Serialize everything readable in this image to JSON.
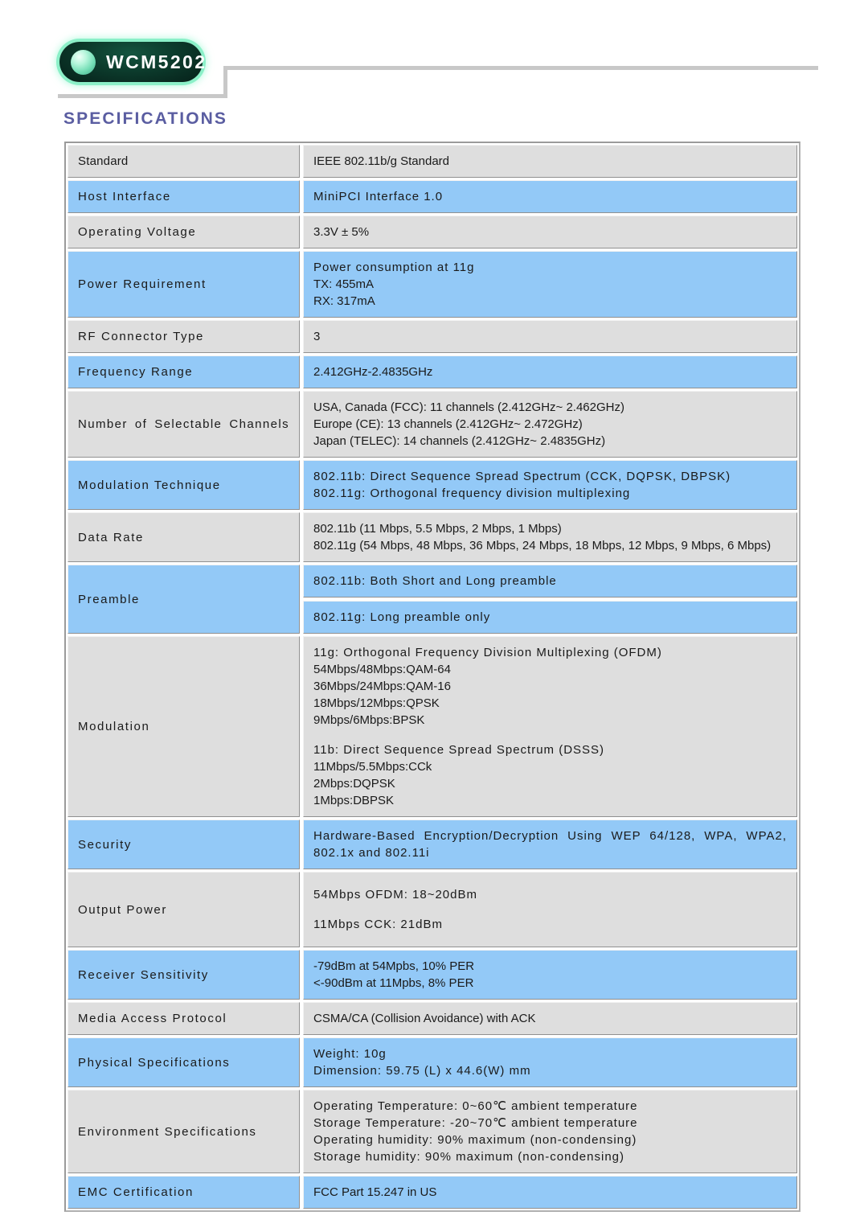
{
  "header": {
    "logo_text": "WCM5202",
    "logo_orb_icon": "sphere-icon"
  },
  "page_title": "SPECIFICATIONS",
  "colors": {
    "title": "#5a5da1",
    "row_blue": "#93c9f7",
    "row_gray": "#dedede",
    "rule": "#c8c8c8",
    "logo_dark": "#0c3b2c",
    "logo_glow": "#8bf0c8"
  },
  "spec_table": {
    "rows": [
      {
        "label": "Standard",
        "tint": "gray",
        "label_style": "normal",
        "value_style": "normal",
        "lines": [
          "IEEE 802.11b/g Standard"
        ]
      },
      {
        "label": "Host Interface",
        "tint": "blue",
        "label_style": "wide",
        "value_style": "wide",
        "lines": [
          "MiniPCI Interface 1.0"
        ]
      },
      {
        "label": "Operating Voltage",
        "tint": "gray",
        "label_style": "wide",
        "value_style": "normal",
        "lines": [
          "3.3V ± 5%"
        ]
      },
      {
        "label": "Power Requirement",
        "tint": "blue",
        "label_style": "wide",
        "value_style": "mixed",
        "lines": [
          "Power consumption at 11g",
          "TX: 455mA",
          "RX: 317mA"
        ]
      },
      {
        "label": "RF Connector Type",
        "tint": "gray",
        "label_style": "wide",
        "value_style": "normal",
        "lines": [
          "3"
        ]
      },
      {
        "label": "Frequency Range",
        "tint": "blue",
        "label_style": "wide",
        "value_style": "normal",
        "lines": [
          "2.412GHz-2.4835GHz"
        ]
      },
      {
        "label": "Number of Selectable Channels",
        "tint": "gray",
        "label_style": "justify",
        "label_words": [
          "Number",
          "of",
          "Selectable",
          "Channels"
        ],
        "value_style": "normal",
        "lines": [
          "USA, Canada (FCC): 11 channels (2.412GHz~ 2.462GHz)",
          "Europe (CE): 13 channels (2.412GHz~ 2.472GHz)",
          "Japan (TELEC): 14 channels (2.412GHz~ 2.4835GHz)"
        ]
      },
      {
        "label": "Modulation Technique",
        "tint": "blue",
        "label_style": "wide",
        "value_style": "wide",
        "lines": [
          "802.11b: Direct Sequence Spread Spectrum (CCK, DQPSK, DBPSK)",
          "802.11g: Orthogonal frequency division multiplexing"
        ]
      },
      {
        "label": "Data Rate",
        "tint": "gray",
        "label_style": "wide",
        "value_style": "normal",
        "lines": [
          "802.11b (11 Mbps, 5.5 Mbps, 2 Mbps, 1 Mbps)",
          "802.11g (54 Mbps, 48 Mbps, 36 Mbps, 24 Mbps, 18 Mbps, 12 Mbps, 9 Mbps, 6 Mbps)"
        ]
      },
      {
        "label": "Preamble",
        "tint": "blue",
        "label_style": "wide",
        "split": true,
        "subcells": [
          "802.11b: Both Short and Long preamble",
          "802.11g: Long preamble only"
        ]
      },
      {
        "label": "Modulation",
        "tint": "gray",
        "label_style": "wide",
        "value_style": "mixed",
        "lines": [
          "11g: Orthogonal Frequency Division Multiplexing (OFDM)",
          "54Mbps/48Mbps:QAM-64",
          "36Mbps/24Mbps:QAM-16",
          "18Mbps/12Mbps:QPSK",
          "9Mbps/6Mbps:BPSK",
          "",
          "11b: Direct Sequence Spread Spectrum (DSSS)",
          "11Mbps/5.5Mbps:CCk",
          "2Mbps:DQPSK",
          "1Mbps:DBPSK"
        ]
      },
      {
        "label": "Security",
        "tint": "blue",
        "label_style": "wide",
        "value_style": "justify",
        "lines": [
          "Hardware-Based Encryption/Decryption Using WEP 64/128, WPA, WPA2, 802.1x and 802.11i"
        ]
      },
      {
        "label": "Output Power",
        "tint": "gray",
        "label_style": "wide",
        "value_style": "spaced",
        "lines": [
          "54Mbps OFDM: 18~20dBm",
          "11Mbps CCK: 21dBm"
        ]
      },
      {
        "label": "Receiver Sensitivity",
        "tint": "blue",
        "label_style": "wide",
        "value_style": "normal",
        "lines": [
          "-79dBm at 54Mpbs, 10% PER",
          "<-90dBm at 11Mpbs, 8% PER"
        ]
      },
      {
        "label": "Media Access Protocol",
        "tint": "gray",
        "label_style": "wide",
        "value_style": "normal",
        "lines": [
          "CSMA/CA (Collision Avoidance) with ACK"
        ]
      },
      {
        "label": "Physical Specifications",
        "tint": "blue",
        "label_style": "wide",
        "value_style": "wide",
        "lines": [
          "Weight: 10g",
          "Dimension: 59.75 (L) x 44.6(W) mm"
        ]
      },
      {
        "label": "Environment Specifications",
        "tint": "gray",
        "label_style": "wide",
        "value_style": "wide",
        "lines": [
          "Operating Temperature: 0~60℃ ambient temperature",
          "Storage Temperature: -20~70℃ ambient temperature",
          "Operating humidity: 90% maximum (non-condensing)",
          "Storage humidity: 90% maximum (non-condensing)"
        ]
      },
      {
        "label": "EMC Certification",
        "tint": "blue",
        "label_style": "wide",
        "value_style": "normal",
        "lines": [
          "FCC Part 15.247 in US"
        ]
      }
    ]
  }
}
